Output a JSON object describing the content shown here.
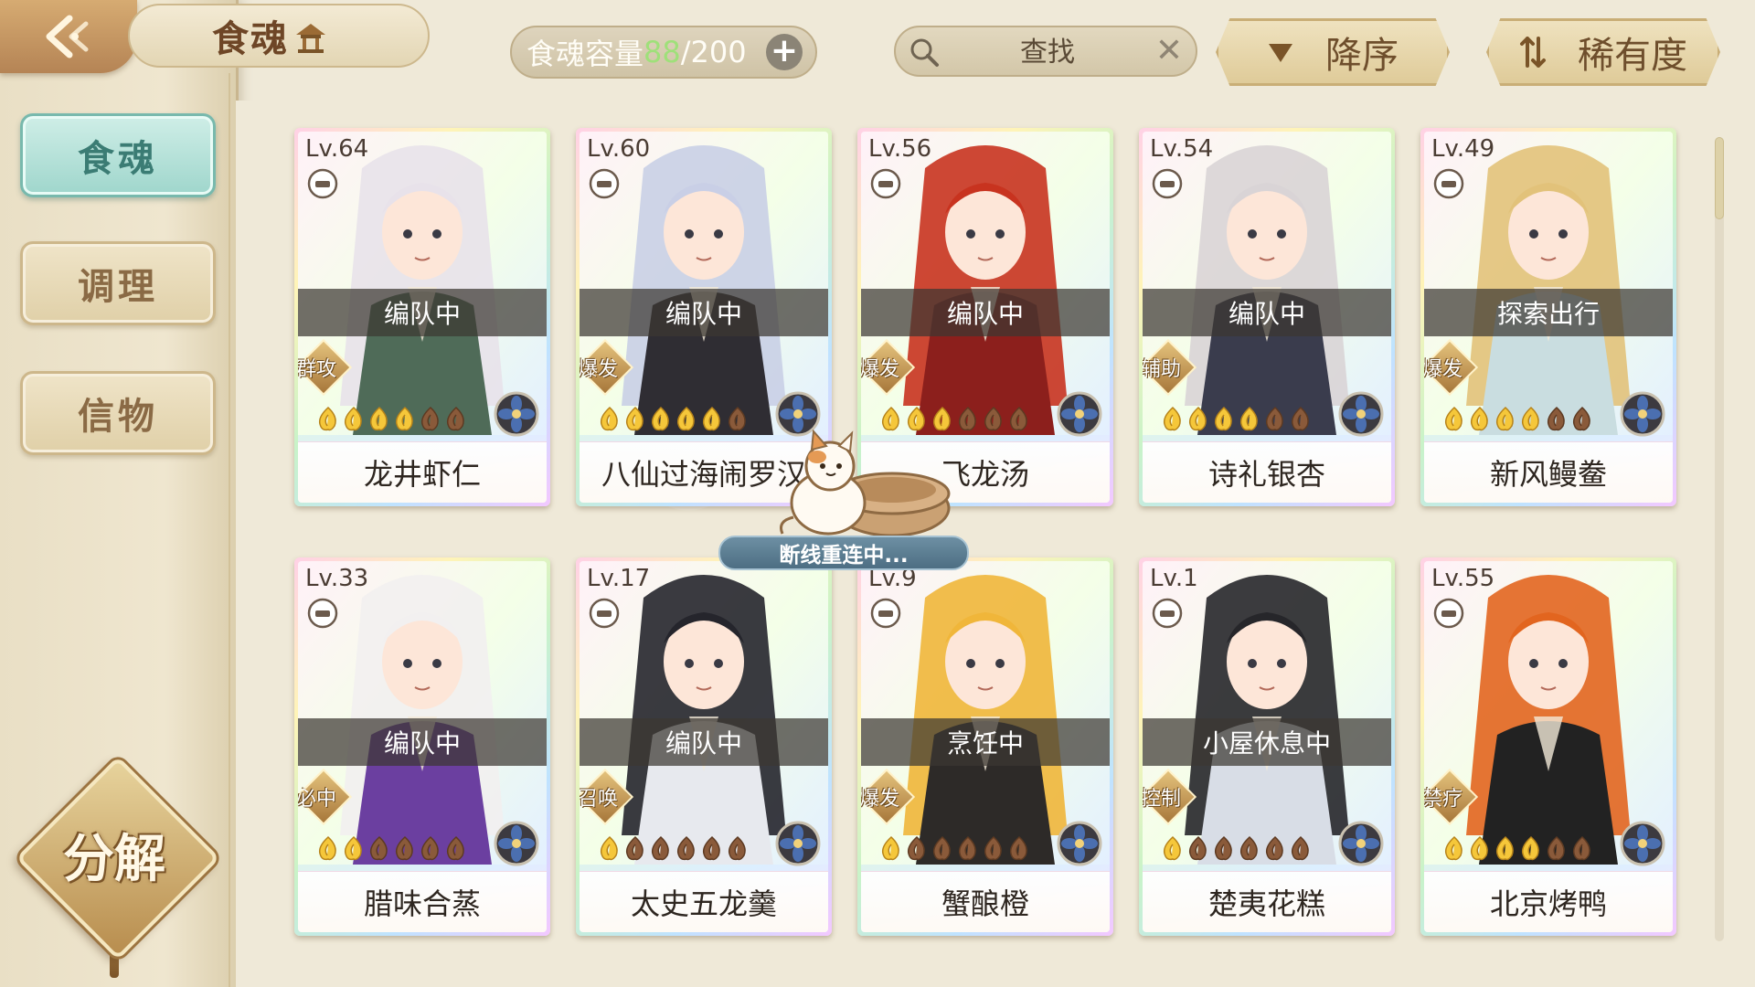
{
  "header": {
    "title": "食魂",
    "capacity": {
      "label": "食魂容量",
      "current": "88",
      "max": "/200",
      "add": "+"
    },
    "search": {
      "placeholder": "查找",
      "clear": "✕"
    },
    "sort_order_label": "降序",
    "sort_rarity_label": "稀有度"
  },
  "sidebar": {
    "tabs": [
      {
        "label": "食魂",
        "active": true
      },
      {
        "label": "调理",
        "active": false
      },
      {
        "label": "信物",
        "active": false
      }
    ],
    "decompose_label": "分解"
  },
  "reconnect": {
    "text": "断线重连中..."
  },
  "colors": {
    "active_tab": "#9fd6cc",
    "status_band": "#3c3732",
    "badge_gold": "#a7773a",
    "capacity_current": "#9fe07a"
  },
  "cards": [
    {
      "level": "Lv.64",
      "status": "编队中",
      "role": "群攻",
      "stars": 4,
      "name": "龙井虾仁",
      "hair": "#e8e2ea",
      "outfit": "#4f6b58"
    },
    {
      "level": "Lv.60",
      "status": "编队中",
      "role": "爆发",
      "stars": 5,
      "name": "八仙过海闹罗汉",
      "hair": "#c9cfe6",
      "outfit": "#2f2d33"
    },
    {
      "level": "Lv.56",
      "status": "编队中",
      "role": "爆发",
      "stars": 3,
      "name": "飞龙汤",
      "hair": "#c8331f",
      "outfit": "#8c1f1c"
    },
    {
      "level": "Lv.54",
      "status": "编队中",
      "role": "辅助",
      "stars": 4,
      "name": "诗礼银杏",
      "hair": "#d9d4d6",
      "outfit": "#3a3c4d"
    },
    {
      "level": "Lv.49",
      "status": "探索出行",
      "role": "爆发",
      "stars": 4,
      "name": "新风鳗鲞",
      "hair": "#e2c27a",
      "outfit": "#c9dde0"
    },
    {
      "level": "Lv.33",
      "status": "编队中",
      "role": "必中",
      "stars": 2,
      "name": "腊味合蒸",
      "hair": "#f2f0f0",
      "outfit": "#6b3fa0"
    },
    {
      "level": "Lv.17",
      "status": "编队中",
      "role": "召唤",
      "stars": 1,
      "name": "太史五龙羹",
      "hair": "#25252c",
      "outfit": "#e7e9ee"
    },
    {
      "level": "Lv.9",
      "status": "烹饪中",
      "role": "爆发",
      "stars": 1,
      "name": "蟹酿橙",
      "hair": "#f0b63a",
      "outfit": "#2d2a28"
    },
    {
      "level": "Lv.1",
      "status": "小屋休息中",
      "role": "控制",
      "stars": 1,
      "name": "楚夷花糕",
      "hair": "#26262a",
      "outfit": "#d8dde6"
    },
    {
      "level": "Lv.55",
      "status": "",
      "role": "禁疗",
      "stars": 4,
      "name": "北京烤鸭",
      "hair": "#e2651f",
      "outfit": "#222222"
    }
  ]
}
